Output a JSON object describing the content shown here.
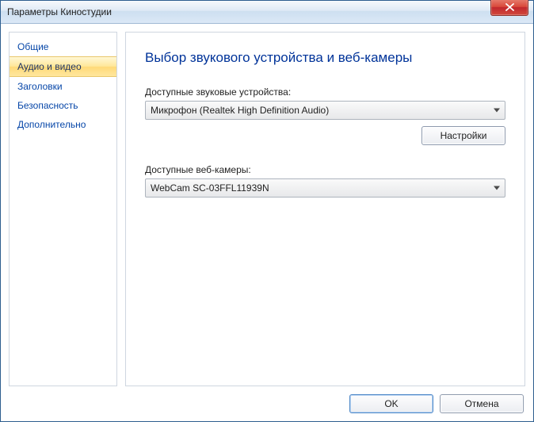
{
  "window": {
    "title": "Параметры Киностудии"
  },
  "sidebar": {
    "items": [
      {
        "label": "Общие"
      },
      {
        "label": "Аудио и видео"
      },
      {
        "label": "Заголовки"
      },
      {
        "label": "Безопасность"
      },
      {
        "label": "Дополнительно"
      }
    ],
    "selected_index": 1
  },
  "main": {
    "heading": "Выбор звукового устройства и веб-камеры",
    "audio": {
      "label": "Доступные звуковые устройства:",
      "selected": "Микрофон (Realtek High Definition Audio)",
      "settings_button": "Настройки"
    },
    "webcam": {
      "label": "Доступные веб-камеры:",
      "selected": "WebCam SC-03FFL11939N"
    }
  },
  "footer": {
    "ok": "OK",
    "cancel": "Отмена"
  }
}
